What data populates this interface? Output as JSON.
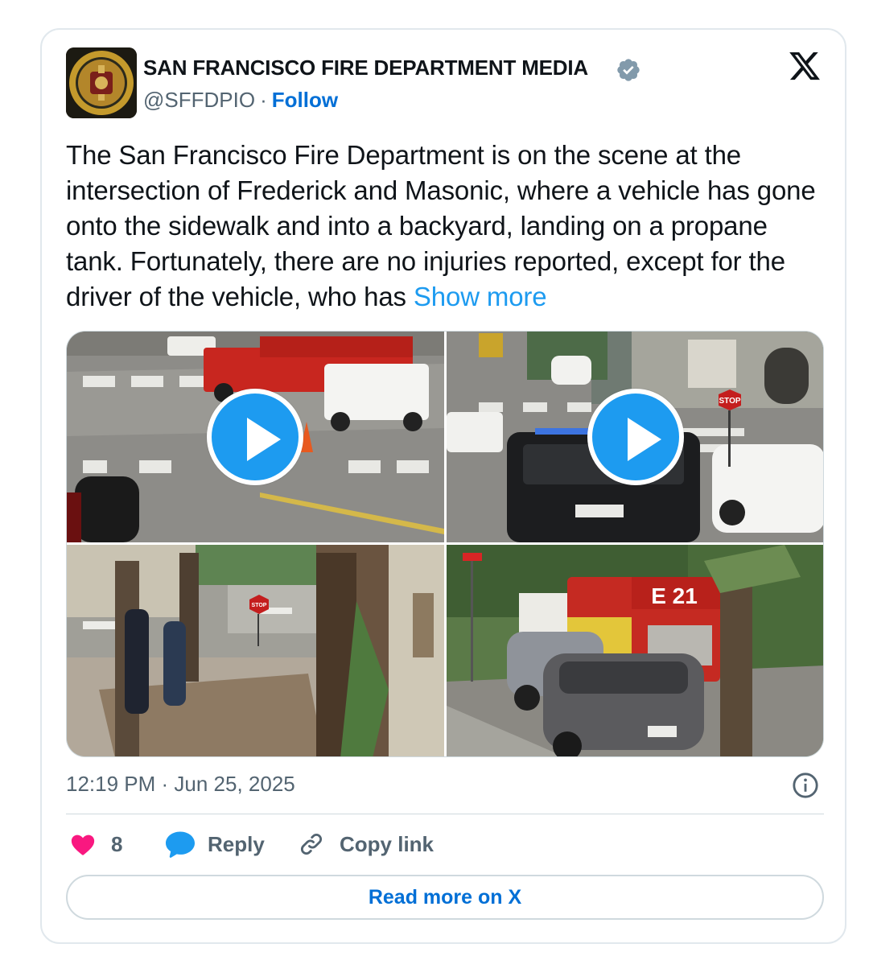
{
  "author": {
    "name": "SAN FRANCISCO FIRE DEPARTMENT MEDIA",
    "handle": "@SFFDPIO",
    "separator": "·",
    "follow_label": "Follow",
    "verified": true
  },
  "brand": {
    "logo": "x-logo-icon"
  },
  "tweet": {
    "text": "The San Francisco Fire Department is on the scene at the intersection of Frederick and Masonic, where a vehicle has gone onto the sidewalk and into a backyard, landing on a propane tank. Fortunately, there are no injuries reported, except for the driver of the vehicle, who has ",
    "show_more_label": "Show more"
  },
  "media": [
    {
      "kind": "video",
      "has_play_button": true
    },
    {
      "kind": "video",
      "has_play_button": true,
      "signs": [
        "STOP"
      ]
    },
    {
      "kind": "photo",
      "signs": [
        "STOP"
      ]
    },
    {
      "kind": "photo",
      "signs": [
        "E 21"
      ]
    }
  ],
  "footer": {
    "timestamp": "12:19 PM · Jun 25, 2025",
    "info_icon": "info-icon"
  },
  "actions": {
    "like_count": "8",
    "reply_label": "Reply",
    "copy_label": "Copy link"
  },
  "read_more_label": "Read more on X",
  "colors": {
    "accent": "#1d9bf0",
    "link": "#006fd6",
    "like": "#f91880",
    "muted": "#536471",
    "border": "#cfd9de"
  }
}
